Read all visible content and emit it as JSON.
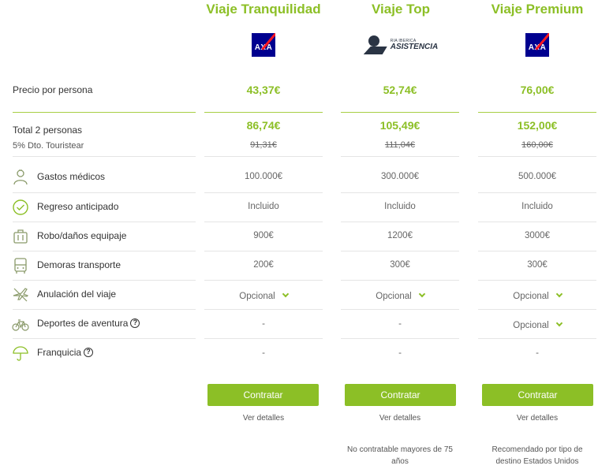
{
  "plans": [
    {
      "name": "Viaje Tranquilidad",
      "logo": "AXA",
      "price_per_person": "43,37€",
      "total": "86,74€",
      "old_total": "91,31€",
      "gastos": "100.000€",
      "regreso": "Incluido",
      "robo": "900€",
      "demoras": "200€",
      "anulacion": "Opcional",
      "deportes": "-",
      "franquicia": "-",
      "button": "Contratar",
      "details": "Ver detalles",
      "note": ""
    },
    {
      "name": "Viaje Top",
      "logo_small": "RIA IBERICA",
      "logo_big": "ASISTENCIA",
      "price_per_person": "52,74€",
      "total": "105,49€",
      "old_total": "111,04€",
      "gastos": "300.000€",
      "regreso": "Incluido",
      "robo": "1200€",
      "demoras": "300€",
      "anulacion": "Opcional",
      "deportes": "-",
      "franquicia": "-",
      "button": "Contratar",
      "details": "Ver detalles",
      "note": "No contratable mayores de 75 años"
    },
    {
      "name": "Viaje Premium",
      "logo": "AXA",
      "price_per_person": "76,00€",
      "total": "152,00€",
      "old_total": "160,00€",
      "gastos": "500.000€",
      "regreso": "Incluido",
      "robo": "3000€",
      "demoras": "300€",
      "anulacion": "Opcional",
      "deportes": "Opcional",
      "franquicia": "-",
      "button": "Contratar",
      "details": "Ver detalles",
      "note": "Recomendado por tipo de destino Estados Unidos"
    }
  ],
  "labels": {
    "price_per_person": "Precio por persona",
    "total": "Total 2 personas",
    "discount": "5% Dto. Touristear",
    "gastos": "Gastos médicos",
    "regreso": "Regreso anticipado",
    "robo": "Robo/daños equipaje",
    "demoras": "Demoras transporte",
    "anulacion": "Anulación del viaje",
    "deportes": "Deportes de aventura",
    "franquicia": "Franquicia",
    "help_glyph": "?"
  },
  "colors": {
    "accent": "#8cbf26",
    "axa_blue": "#00008f",
    "axa_red": "#ff1721",
    "icon": "#8a9a6a"
  }
}
